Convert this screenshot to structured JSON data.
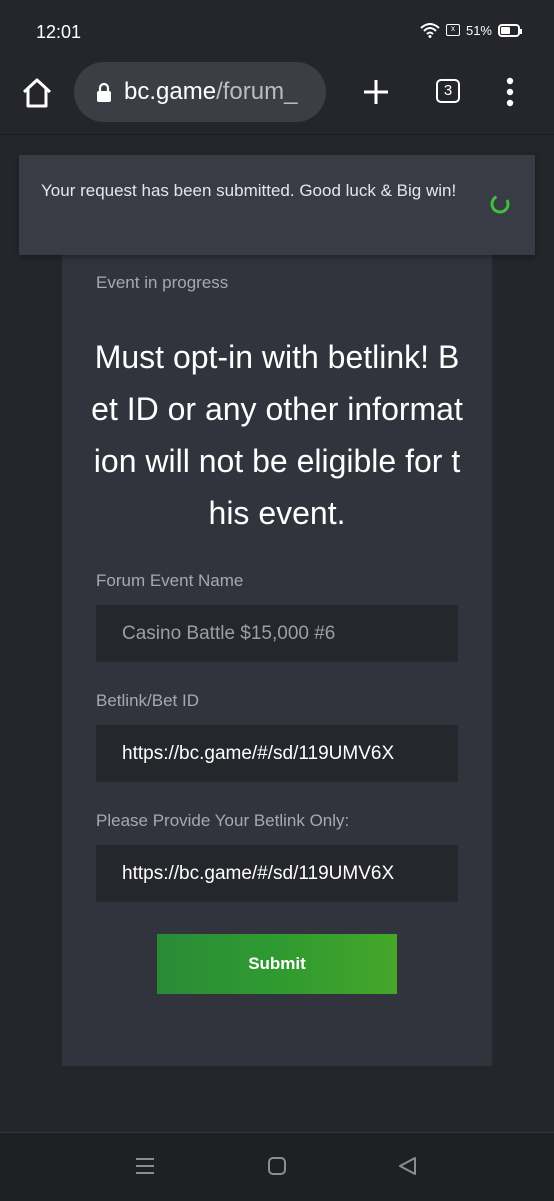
{
  "status_bar": {
    "time": "12:01",
    "battery_percent": "51%",
    "sim_label": "x"
  },
  "browser": {
    "url_host": "bc.game",
    "url_path": "/forum_",
    "tab_count": "3"
  },
  "toast": {
    "message": "Your request has been submitted. Good luck & Big win!",
    "spinner_color": "#3fbf3a"
  },
  "event": {
    "status": "Event in progress",
    "title": "Must opt-in with betlink! Bet ID or any other information will not be eligible for this event."
  },
  "form": {
    "event_name_label": "Forum Event Name",
    "event_name_value": "Casino Battle $15,000 #6",
    "betlink_label": "Betlink/Bet ID",
    "betlink_value": "https://bc.game/#/sd/119UMV6X",
    "betlink_only_label": "Please Provide Your Betlink Only:",
    "betlink_only_value": "https://bc.game/#/sd/119UMV6X",
    "submit_label": "Submit"
  },
  "colors": {
    "accent_green": "#2f9a30",
    "page_bg": "#24262b",
    "card_bg": "#31343c"
  }
}
